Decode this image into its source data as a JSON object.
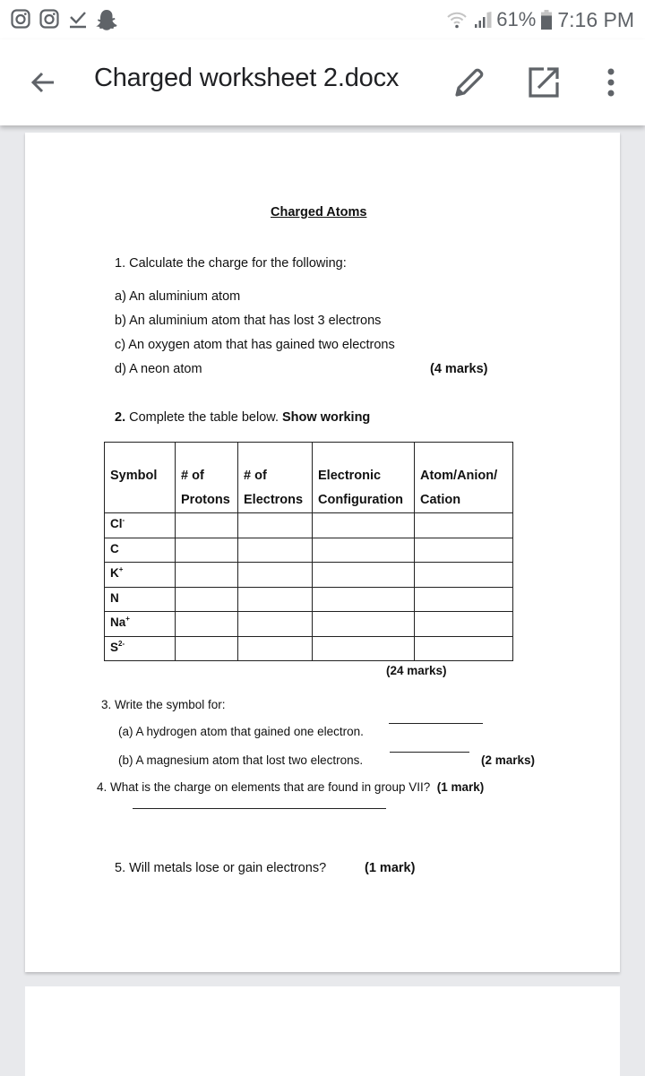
{
  "status_bar": {
    "notification_icons": [
      "instagram-icon",
      "instagram-icon",
      "download-done-icon",
      "snapchat-icon"
    ],
    "wifi_icon": "wifi-icon",
    "signal_icon": "cell-signal-icon",
    "battery_percent": "61%",
    "battery_icon": "battery-icon",
    "time": "7:16 PM"
  },
  "app_bar": {
    "back_icon": "arrow-back-icon",
    "title": "Charged worksheet 2.docx",
    "actions": [
      "edit-pencil-icon",
      "open-external-icon",
      "more-vert-icon"
    ]
  },
  "document": {
    "heading": "Charged Atoms",
    "q1": {
      "prompt": "1. Calculate the charge for the following:",
      "items": [
        "a) An aluminium atom",
        "b) An aluminium atom that has lost 3 electrons",
        "c) An oxygen atom that has gained two electrons",
        "d) A neon atom"
      ],
      "marks": "(4 marks)"
    },
    "q2": {
      "number": "2.",
      "prompt": "Complete the table below.",
      "emphasis": "Show working",
      "table": {
        "headers": [
          [
            "Symbol",
            ""
          ],
          [
            "# of",
            "Protons"
          ],
          [
            "# of",
            "Electrons"
          ],
          [
            "Electronic",
            "Configuration"
          ],
          [
            "Atom/Anion/",
            "Cation"
          ]
        ],
        "rows": [
          {
            "symbol": "Cl",
            "charge": "-"
          },
          {
            "symbol": "C",
            "charge": ""
          },
          {
            "symbol": "K",
            "charge": "+"
          },
          {
            "symbol": "N",
            "charge": ""
          },
          {
            "symbol": "Na",
            "charge": "+"
          },
          {
            "symbol": "S",
            "charge": "2-"
          }
        ]
      },
      "marks": "(24 marks)"
    },
    "q3": {
      "prompt": "3. Write the symbol for:",
      "a": "(a) A hydrogen atom that gained one electron.",
      "b": "(b) A magnesium atom that lost two electrons.",
      "marks": "(2 marks)"
    },
    "q4": {
      "prompt": "4. What is the charge on elements that are found in group VII?",
      "marks": "(1 mark)"
    },
    "q5": {
      "prompt": "5.  Will metals lose or gain electrons?",
      "marks": "(1 mark)"
    }
  }
}
